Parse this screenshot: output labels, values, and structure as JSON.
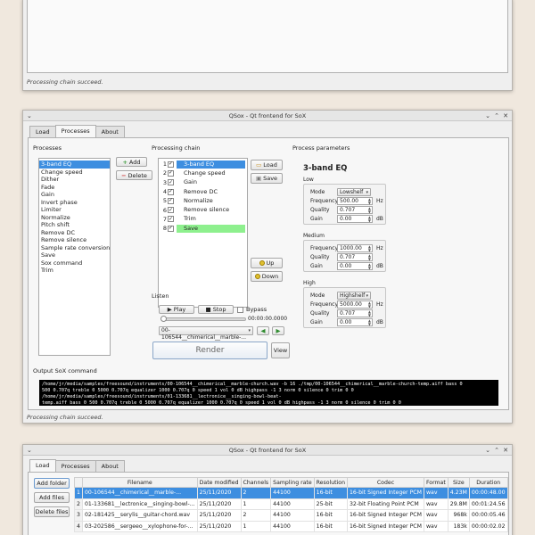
{
  "window1": {
    "status": "Processing chain succeed."
  },
  "window2": {
    "title": "QSox - Qt frontend for SoX",
    "tabs": [
      {
        "label": "Load"
      },
      {
        "label": "Processes"
      },
      {
        "label": "About"
      }
    ],
    "processes_label": "Processes",
    "processes": [
      "3-band EQ",
      "Change speed",
      "Dither",
      "Fade",
      "Gain",
      "Invert phase",
      "Limiter",
      "Normalize",
      "Pitch shift",
      "Remove DC",
      "Remove silence",
      "Sample rate conversion",
      "Save",
      "Sox command",
      "Trim"
    ],
    "add_label": "Add",
    "delete_label": "Delete",
    "chain_label": "Processing chain",
    "chain": [
      {
        "num": "1",
        "check": "✓",
        "name": "3-band EQ"
      },
      {
        "num": "2",
        "check": "✓",
        "name": "Change speed"
      },
      {
        "num": "3",
        "check": "✓",
        "name": "Gain"
      },
      {
        "num": "4",
        "check": "✓",
        "name": "Remove DC"
      },
      {
        "num": "5",
        "check": "✓",
        "name": "Normalize"
      },
      {
        "num": "6",
        "check": "✓",
        "name": "Remove silence"
      },
      {
        "num": "7",
        "check": "✓",
        "name": "Trim"
      },
      {
        "num": "8",
        "check": "✓",
        "name": "Save"
      }
    ],
    "load_label": "Load",
    "save_label": "Save",
    "up_label": "Up",
    "down_label": "Down",
    "params_label": "Process parameters",
    "eq_title": "3-band EQ",
    "bands": [
      {
        "name": "Low",
        "mode_label": "Mode",
        "mode": "Lowshelf",
        "freq_label": "Frequency",
        "freq": "500.00",
        "freq_unit": "Hz",
        "q_label": "Quality",
        "q": "0.707",
        "gain_label": "Gain",
        "gain": "0.00",
        "gain_unit": "dB"
      },
      {
        "name": "Medium",
        "freq_label": "Frequency",
        "freq": "1000.00",
        "freq_unit": "Hz",
        "q_label": "Quality",
        "q": "0.707",
        "gain_label": "Gain",
        "gain": "0.00",
        "gain_unit": "dB"
      },
      {
        "name": "High",
        "mode_label": "Mode",
        "mode": "Highshelf",
        "freq_label": "Frequency",
        "freq": "5000.00",
        "freq_unit": "Hz",
        "q_label": "Quality",
        "q": "0.707",
        "gain_label": "Gain",
        "gain": "0.00",
        "gain_unit": "dB"
      }
    ],
    "listen_label": "Listen",
    "play_label": "Play",
    "stop_label": "Stop",
    "bypass_label": "Bypass",
    "time": "00:00:00.0000",
    "listen_file": "00-106544__chimerical__marble-...",
    "render_label": "Render",
    "view_label": "View",
    "output_label": "Output SoX command",
    "console_lines": [
      "/home/jr/media/samples/freesound/instruments/00-106544__chimerical__marble-church.wav -b 16 ./tmp/00-106544__chimerical__marble-church-temp.aiff bass 0",
      "500 0.707q treble 0 5000 0.707q equalizer 1000 0.707q 0 speed 1 vol 0 dB highpass -1 3 norm 0 silence 0 trim 0 0",
      "/home/jr/media/samples/freesound/instruments/01-133681__lectronice__singing-bowl-beat-",
      "temp.aiff bass 0 500 0.707q treble 0 5000 0.707q equalizer 1000 0.707q 0 speed 1 vol 0 dB highpass -1 3 norm 0 silence 0 trim 0 0"
    ],
    "status": "Processing chain succeed."
  },
  "window3": {
    "title": "QSox - Qt frontend for SoX",
    "tabs": [
      {
        "label": "Load"
      },
      {
        "label": "Processes"
      },
      {
        "label": "About"
      }
    ],
    "add_folder_label": "Add folder",
    "add_files_label": "Add files",
    "delete_files_label": "Delete files",
    "columns": [
      "",
      "Filename",
      "Date modified",
      "Channels",
      "Sampling rate",
      "Resolution",
      "Codec",
      "Format",
      "Size",
      "Duration"
    ],
    "rows": [
      [
        "1",
        "00-106544__chimerical__marble-...",
        "25/11/2020",
        "2",
        "44100",
        "16-bit",
        "16-bit Signed Integer PCM",
        "wav",
        "4.23M",
        "00:00:48.00"
      ],
      [
        "2",
        "01-133681__lectronice__singing-bowl-...",
        "25/11/2020",
        "1",
        "44100",
        "25-bit",
        "32-bit Floating Point PCM",
        "wav",
        "29.8M",
        "00:01:24.56"
      ],
      [
        "3",
        "02-181425__serylis__guitar-chord.wav",
        "25/11/2020",
        "2",
        "44100",
        "16-bit",
        "16-bit Signed Integer PCM",
        "wav",
        "968k",
        "00:00:05.46"
      ],
      [
        "4",
        "03-202586__sergeeo__xylophone-for-...",
        "25/11/2020",
        "1",
        "44100",
        "16-bit",
        "16-bit Signed Integer PCM",
        "wav",
        "183k",
        "00:00:02.02"
      ]
    ]
  }
}
